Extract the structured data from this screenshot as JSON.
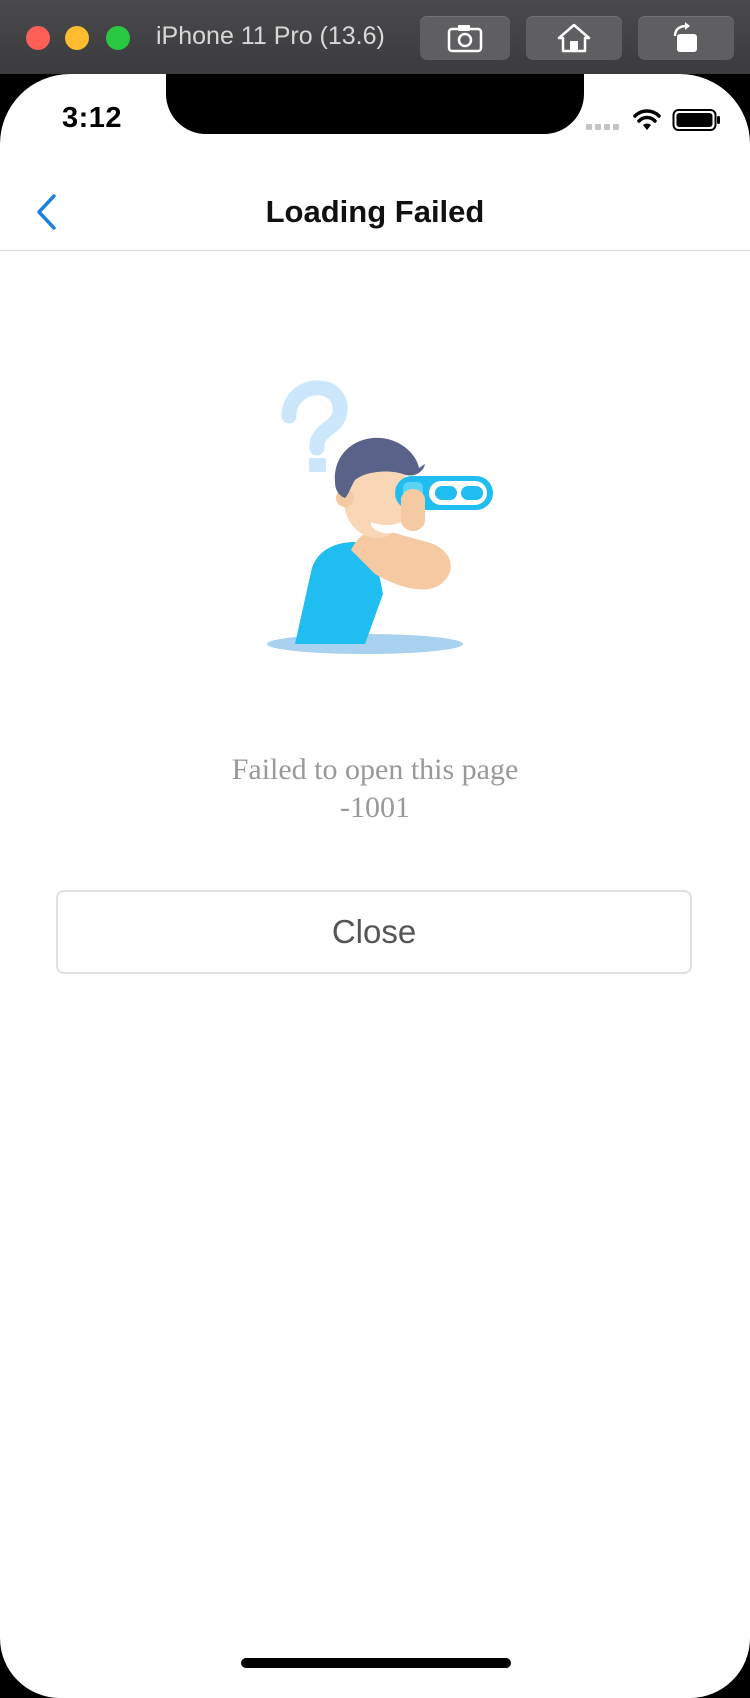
{
  "simulator": {
    "device_title": "iPhone 11 Pro (13.6)",
    "toolbar_icons": [
      "screenshot-icon",
      "home-icon",
      "rotate-icon"
    ]
  },
  "status_bar": {
    "time": "3:12"
  },
  "nav": {
    "title": "Loading Failed",
    "back_icon": "chevron-left-icon"
  },
  "error": {
    "message": "Failed to open this page",
    "code": "-1001"
  },
  "actions": {
    "close_label": "Close"
  },
  "colors": {
    "accent": "#1d7fe0",
    "illustration_blue": "#20bdf0",
    "illustration_light_blue": "#a9d1f0",
    "hair": "#5a6289",
    "skin": "#f5c9a2"
  }
}
